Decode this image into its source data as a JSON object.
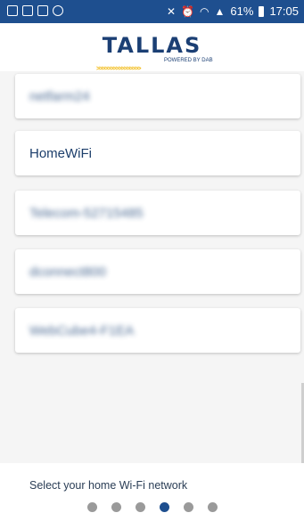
{
  "status_bar": {
    "battery_percent": "61%",
    "time": "17:05",
    "left_icons": [
      "notification-app-icon",
      "gallery-icon",
      "video-icon",
      "circle-icon"
    ],
    "right_icons": [
      "mute-icon",
      "alarm-icon",
      "wifi-icon",
      "signal-icon",
      "battery-icon"
    ]
  },
  "header": {
    "logo_text": "TALLAS",
    "logo_sub": "POWERED BY DAB",
    "logo_chevrons": ">>>>>>>>>>>>>>>>"
  },
  "networks": [
    {
      "ssid": "netfarm24",
      "blurred": true
    },
    {
      "ssid": "HomeWiFi",
      "blurred": false
    },
    {
      "ssid": "Telecom-52715485",
      "blurred": true
    },
    {
      "ssid": "dconnect800",
      "blurred": true
    },
    {
      "ssid": "WebCube4-F1EA",
      "blurred": true
    }
  ],
  "footer": {
    "instruction": "Select your home Wi-Fi network",
    "page_count": 6,
    "active_page": 4
  },
  "colors": {
    "primary": "#1e4f8f",
    "logo": "#1b3f74",
    "accent": "#f0b400",
    "inactive_dot": "#9a9a9a"
  }
}
